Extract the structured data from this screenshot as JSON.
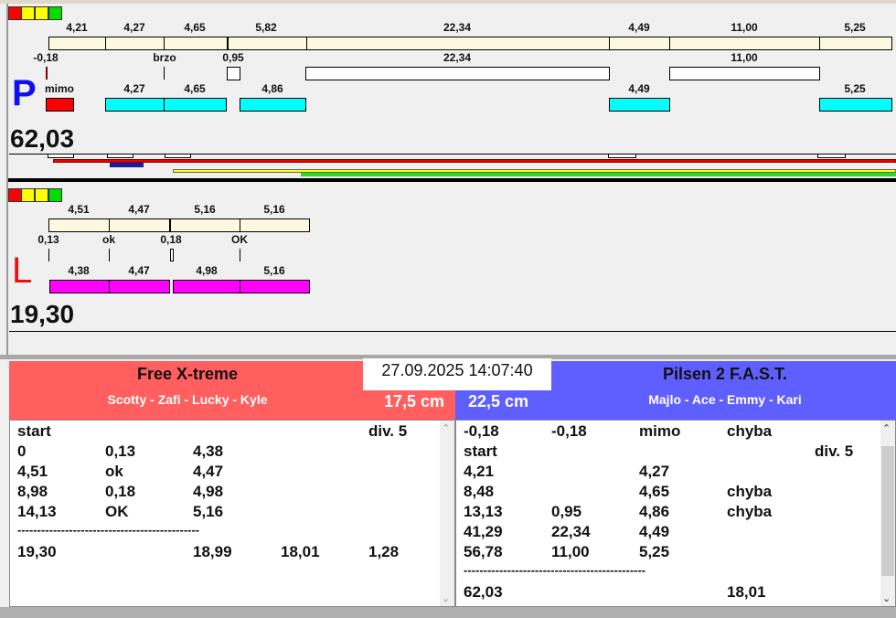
{
  "colors": {
    "red": "#ff0000",
    "yellow": "#ffff00",
    "green": "#00dd00",
    "team_red": "#ff5f5f",
    "team_blue": "#5f5fff",
    "cyan": "#00ffff",
    "magenta": "#ff00ff"
  },
  "p": {
    "letter": "P",
    "total": "62,03",
    "top_labels": [
      "4,21",
      "4,27",
      "4,65",
      "5,82",
      "22,34",
      "4,49",
      "11,00",
      "5,25"
    ],
    "mid_labels": [
      "-0,18",
      "brzo",
      "0,95",
      "22,34",
      "11,00"
    ],
    "bot_labels": [
      "mimo",
      "4,27",
      "4,65",
      "4,86",
      "4,49",
      "5,25"
    ]
  },
  "l": {
    "letter": "L",
    "total": "19,30",
    "top_labels": [
      "4,51",
      "4,47",
      "5,16",
      "5,16"
    ],
    "mid_labels": [
      "0,13",
      "ok",
      "0,18",
      "OK"
    ],
    "bot_labels": [
      "4,38",
      "4,47",
      "4,98",
      "5,16"
    ]
  },
  "datetime": "27.09.2025 14:07:40",
  "left_team": {
    "name": "Free X-treme",
    "dogs": "Scotty - Zafi - Lucky - Kyle",
    "height": "17,5 cm",
    "rows": [
      [
        "start",
        "",
        "",
        "",
        "div.  5"
      ],
      [
        "0",
        "0,13",
        "4,38",
        "",
        ""
      ],
      [
        "4,51",
        "ok",
        "4,47",
        "",
        ""
      ],
      [
        "8,98",
        "0,18",
        "4,98",
        "",
        ""
      ],
      [
        "14,13",
        "OK",
        "5,16",
        "",
        ""
      ],
      [
        "----------------------------------------------",
        "",
        "",
        "",
        ""
      ],
      [
        "19,30",
        "",
        "18,99",
        "18,01",
        "1,28"
      ]
    ]
  },
  "right_team": {
    "name": "Pilsen 2 F.A.S.T.",
    "dogs": "Majlo - Ace - Emmy - Kari",
    "height": "22,5 cm",
    "rows": [
      [
        "-0,18",
        "-0,18",
        "mimo",
        "chyba",
        ""
      ],
      [
        "start",
        "",
        "",
        "",
        "div.  5"
      ],
      [
        "4,21",
        "",
        "4,27",
        "",
        ""
      ],
      [
        "8,48",
        "",
        "4,65",
        "chyba",
        ""
      ],
      [
        "13,13",
        "0,95",
        "4,86",
        "chyba",
        ""
      ],
      [
        "41,29",
        "22,34",
        "4,49",
        "",
        ""
      ],
      [
        "56,78",
        "11,00",
        "5,25",
        "",
        ""
      ],
      [
        "----------------------------------------------",
        "",
        "",
        "",
        ""
      ],
      [
        "62,03",
        "",
        "",
        "18,01",
        ""
      ]
    ]
  }
}
